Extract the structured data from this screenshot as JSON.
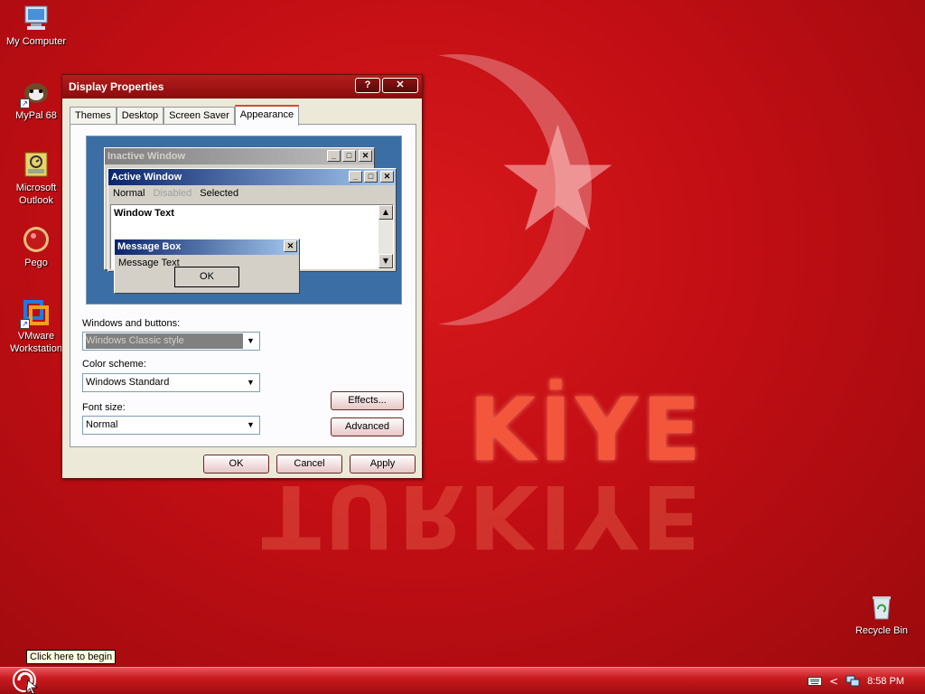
{
  "desktop": {
    "wallpaper_text": "KİYE",
    "wallpaper_reflection": "TURKIYE",
    "icons": [
      {
        "label": "My Computer",
        "icon": "computer-icon"
      },
      {
        "label": "MyPal 68",
        "icon": "browser-icon"
      },
      {
        "label": "Microsoft Outlook",
        "icon": "outlook-icon"
      },
      {
        "label": "Pego",
        "icon": "pego-icon"
      },
      {
        "label": "VMware Workstation",
        "icon": "vmware-icon"
      },
      {
        "label": "Recycle Bin",
        "icon": "recycle-bin-icon"
      }
    ]
  },
  "dialog": {
    "title": "Display Properties",
    "help_label": "?",
    "close_label": "✕",
    "tabs": [
      "Themes",
      "Desktop",
      "Screen Saver",
      "Appearance"
    ],
    "active_tab": "Appearance",
    "preview": {
      "inactive_title": "Inactive Window",
      "active_title": "Active Window",
      "menu": {
        "normal": "Normal",
        "disabled": "Disabled",
        "selected": "Selected"
      },
      "window_text": "Window Text",
      "msgbox_title": "Message Box",
      "msgbox_text": "Message Text",
      "msgbox_ok": "OK"
    },
    "windows_buttons_label": "Windows and buttons:",
    "windows_buttons_value": "Windows Classic style",
    "color_scheme_label": "Color scheme:",
    "color_scheme_value": "Windows Standard",
    "font_size_label": "Font size:",
    "font_size_value": "Normal",
    "effects_label": "Effects...",
    "advanced_label": "Advanced",
    "ok_label": "OK",
    "cancel_label": "Cancel",
    "apply_label": "Apply"
  },
  "taskbar": {
    "start_tooltip": "Click here to begin",
    "clock": "8:58 PM"
  },
  "colors": {
    "desktop_red": "#c10e14",
    "title_red": "#8a0c0c",
    "preview_blue": "#3a6ea5",
    "active_title": "#0a246a",
    "inactive_title": "#808080"
  }
}
